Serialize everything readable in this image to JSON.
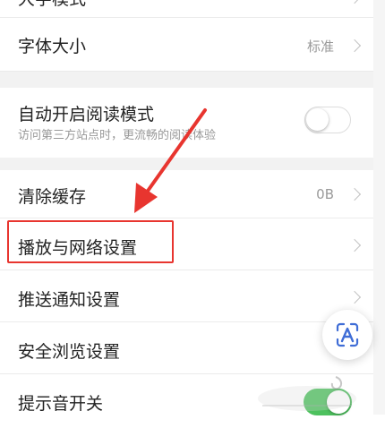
{
  "settings": {
    "row_cut_label": "大字模式",
    "font_size": {
      "label": "字体大小",
      "value": "标准"
    },
    "auto_read": {
      "label": "自动开启阅读模式",
      "sub": "访问第三方站点时，更流畅的阅读体验",
      "enabled": false
    },
    "clear_cache": {
      "label": "清除缓存",
      "value": "0B"
    },
    "playback_network": {
      "label": "播放与网络设置"
    },
    "push": {
      "label": "推送通知设置"
    },
    "safe_browse": {
      "label": "安全浏览设置"
    },
    "sound": {
      "label": "提示音开关",
      "enabled": true
    }
  },
  "annotation": {
    "arrow_color": "#e8352f",
    "box_color": "#e8352f"
  },
  "colors": {
    "toggle_on": "#4dc15e",
    "floating_icon": "#3f6dd6"
  },
  "icons": {
    "chevron": "chevron-right-icon",
    "floating": "text-recognition-icon"
  }
}
